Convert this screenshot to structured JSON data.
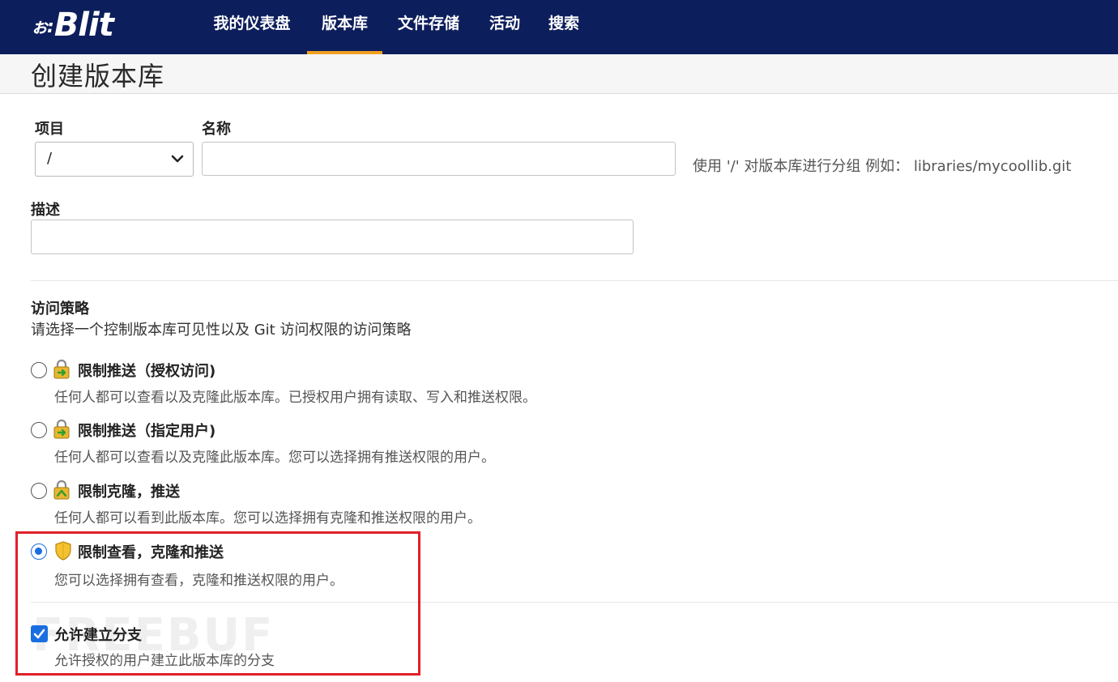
{
  "app": {
    "logo_mark": "ぉ:",
    "logo_text": "Blit"
  },
  "nav": {
    "items": [
      {
        "label": "我的仪表盘",
        "active": false
      },
      {
        "label": "版本库",
        "active": true
      },
      {
        "label": "文件存储",
        "active": false
      },
      {
        "label": "活动",
        "active": false
      },
      {
        "label": "搜索",
        "active": false
      }
    ],
    "accent_color": "#f0a020",
    "background_color": "#0d1e5c"
  },
  "page": {
    "title": "创建版本库"
  },
  "form": {
    "project_label": "项目",
    "project_value": "/",
    "name_label": "名称",
    "name_value": "",
    "name_hint": "使用 '/' 对版本库进行分组 例如： libraries/mycoollib.git",
    "description_label": "描述",
    "description_value": ""
  },
  "access_policy": {
    "title": "访问策略",
    "subtitle": "请选择一个控制版本库可见性以及 Git 访问权限的访问策略",
    "options": [
      {
        "title": "限制推送（授权访问)",
        "description": "任何人都可以查看以及克隆此版本库。已授权用户拥有读取、写入和推送权限。",
        "icon": "lock-push-icon",
        "selected": false
      },
      {
        "title": "限制推送（指定用户)",
        "description": "任何人都可以查看以及克隆此版本库。您可以选择拥有推送权限的用户。",
        "icon": "lock-push-icon",
        "selected": false
      },
      {
        "title": "限制克隆，推送",
        "description": "任何人都可以看到此版本库。您可以选择拥有克隆和推送权限的用户。",
        "icon": "lock-clone-icon",
        "selected": false
      },
      {
        "title": "限制查看，克隆和推送",
        "description": "您可以选择拥有查看，克隆和推送权限的用户。",
        "icon": "shield-icon",
        "selected": true
      }
    ]
  },
  "allow_fork": {
    "title": "允许建立分支",
    "description": "允许授权的用户建立此版本库的分支",
    "checked": true
  },
  "watermark": "FREEBUF"
}
